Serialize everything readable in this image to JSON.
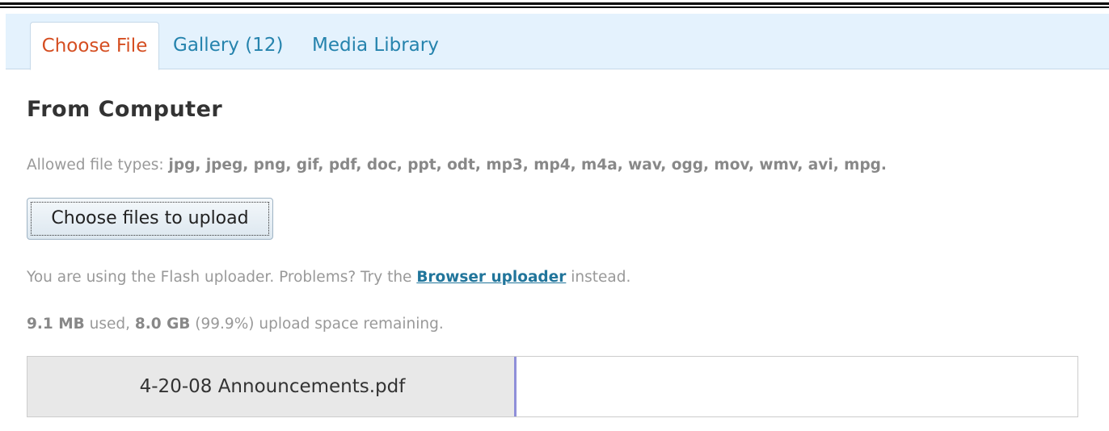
{
  "tabs": {
    "choose_file": "Choose File",
    "gallery": "Gallery (12)",
    "media_library": "Media Library"
  },
  "section_title": "From Computer",
  "allowed": {
    "label": "Allowed file types:",
    "types": "jpg, jpeg, png, gif, pdf, doc, ppt, odt, mp3, mp4, m4a, wav, ogg, mov, wmv, avi, mpg."
  },
  "upload_button_label": "Choose files to upload",
  "flash_note": {
    "prefix": "You are using the Flash uploader. Problems? Try the",
    "link": "Browser uploader",
    "suffix": "instead."
  },
  "space": {
    "used": "9.1 MB",
    "used_suffix": "used,",
    "remaining": "8.0 GB",
    "remaining_suffix": "(99.9%) upload space remaining."
  },
  "upload_item": {
    "filename": "4-20-08 Announcements.pdf",
    "progress": 0.466
  },
  "colors": {
    "tab_active": "#d54e21",
    "link": "#2583ad",
    "tabbar_bg": "#e4f2fd",
    "progress_marker": "#8f8fd9"
  }
}
